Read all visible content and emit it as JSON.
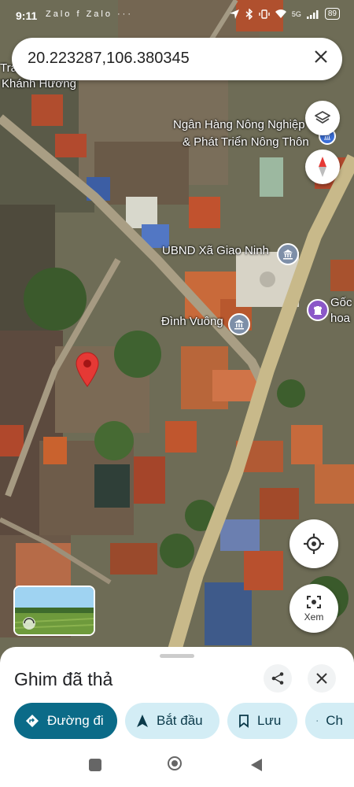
{
  "status_bar": {
    "time": "9:11",
    "notification_icons": "Zalo f Zalo ···",
    "signal_label": "5G",
    "battery": "89"
  },
  "search": {
    "query": "20.223287,106.380345"
  },
  "map_labels": {
    "top_left_line1": "Tra",
    "top_left_line2": "Khánh Hương",
    "bank_line1": "Ngân Hàng Nông Nghiệp",
    "bank_line2": "& Phát Triển Nông Thôn",
    "ubnd": "UBND Xã Giao Ninh",
    "dinh_vuong": "Đình Vuông",
    "right_line1": "Gốc",
    "right_line2": "hoa"
  },
  "xem_button": {
    "label": "Xem"
  },
  "sheet": {
    "title": "Ghim đã thả",
    "chips": {
      "directions": "Đường đi",
      "start": "Bắt đầu",
      "save": "Lưu",
      "share": "Ch"
    }
  },
  "colors": {
    "primary_chip": "#0b6b88",
    "secondary_chip": "#d3edf5",
    "pin_red": "#e53935",
    "road": "#c8b98a"
  },
  "icons": [
    "close-icon",
    "layers-icon",
    "compass-icon",
    "my-location-icon",
    "lens-icon",
    "share-icon",
    "directions-icon",
    "navigation-icon",
    "bookmark-icon"
  ]
}
